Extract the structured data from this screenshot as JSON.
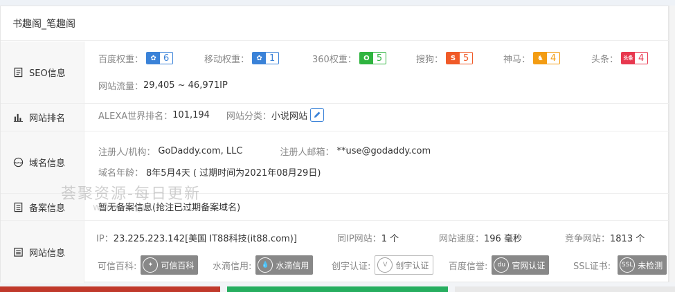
{
  "site_title": "书趣阁_笔趣阁",
  "seo": {
    "label": "SEO信息",
    "ranks": [
      {
        "name": "百度权重：",
        "value": "6",
        "color": "#3a82d8"
      },
      {
        "name": "移动权重：",
        "value": "1",
        "color": "#3a82d8"
      },
      {
        "name": "360权重：",
        "value": "5",
        "color": "#2fb43f"
      },
      {
        "name": "搜狗：",
        "value": "5",
        "color": "#f05a28"
      },
      {
        "name": "神马：",
        "value": "4",
        "color": "#f39c12"
      },
      {
        "name": "头条：",
        "value": "4",
        "color": "#e8384f"
      }
    ],
    "traffic_label": "网站流量：",
    "traffic_value": "29,405 ~ 46,971IP"
  },
  "ranking": {
    "label": "网站排名",
    "alexa_label": "ALEXA世界排名：",
    "alexa_value": "101,194",
    "category_label": "网站分类：",
    "category_value": "小说网站"
  },
  "domain": {
    "label": "域名信息",
    "registrant_label": "注册人/机构：",
    "registrant_value": "GoDaddy.com, LLC",
    "email_label": "注册人邮箱：",
    "email_value": "**use@godaddy.com",
    "age_label": "域名年龄：",
    "age_value": "8年5月4天 ( 过期时间为2021年08月29日)"
  },
  "record": {
    "label": "备案信息",
    "value": "暂无备案信息(抢注已过期备案域名)"
  },
  "site": {
    "label": "网站信息",
    "ip_label": "IP：",
    "ip_value": "23.225.223.142[美国 IT88科技(it88.com)]",
    "same_ip_label": "同IP网站：",
    "same_ip_value": "1 个",
    "speed_label": "网站速度：",
    "speed_value": "196 毫秒",
    "competitor_label": "竞争网站：",
    "competitor_value": "1813 个",
    "certs": [
      {
        "label": "可信百科:",
        "badge": "可信百科",
        "style": "dark"
      },
      {
        "label": "水滴信用:",
        "badge": "水滴信用",
        "style": "dark"
      },
      {
        "label": "创宇认证:",
        "badge": "创宇认证",
        "style": "light"
      },
      {
        "label": "百度信誉:",
        "badge": "官网认证",
        "style": "dark"
      },
      {
        "label": "SSL证书:",
        "badge": "未检测",
        "style": "dark"
      }
    ]
  },
  "watermark": {
    "line1": "荟聚资源-每日更新",
    "line2": "www.huiju.in"
  }
}
